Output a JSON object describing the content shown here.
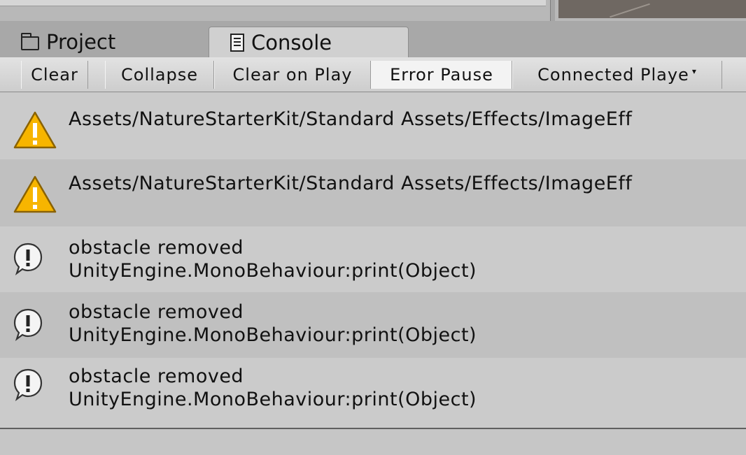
{
  "tabs": [
    {
      "label": "Project",
      "icon": "folder-icon",
      "active": false
    },
    {
      "label": "Console",
      "icon": "console-icon",
      "active": true
    }
  ],
  "toolbar": {
    "clear_label": "Clear",
    "collapse_label": "Collapse",
    "clear_on_play_label": "Clear on Play",
    "error_pause_label": "Error Pause",
    "connected_player_label": "Connected Playe",
    "connected_player_caret": "▾"
  },
  "logs": [
    {
      "type": "warning",
      "icon": "warning-icon",
      "line1": "Assets/NatureStarterKit/Standard Assets/Effects/ImageEff",
      "line2": ""
    },
    {
      "type": "warning",
      "icon": "warning-icon",
      "line1": "Assets/NatureStarterKit/Standard Assets/Effects/ImageEff",
      "line2": ""
    },
    {
      "type": "info",
      "icon": "info-icon",
      "line1": "obstacle removed",
      "line2": "UnityEngine.MonoBehaviour:print(Object)"
    },
    {
      "type": "info",
      "icon": "info-icon",
      "line1": "obstacle removed",
      "line2": "UnityEngine.MonoBehaviour:print(Object)"
    },
    {
      "type": "info",
      "icon": "info-icon",
      "line1": "obstacle removed",
      "line2": "UnityEngine.MonoBehaviour:print(Object)"
    }
  ],
  "colors": {
    "warning_fill": "#f7b500",
    "warning_stroke": "#8a6200",
    "panel_bg": "#c2c2c2"
  }
}
